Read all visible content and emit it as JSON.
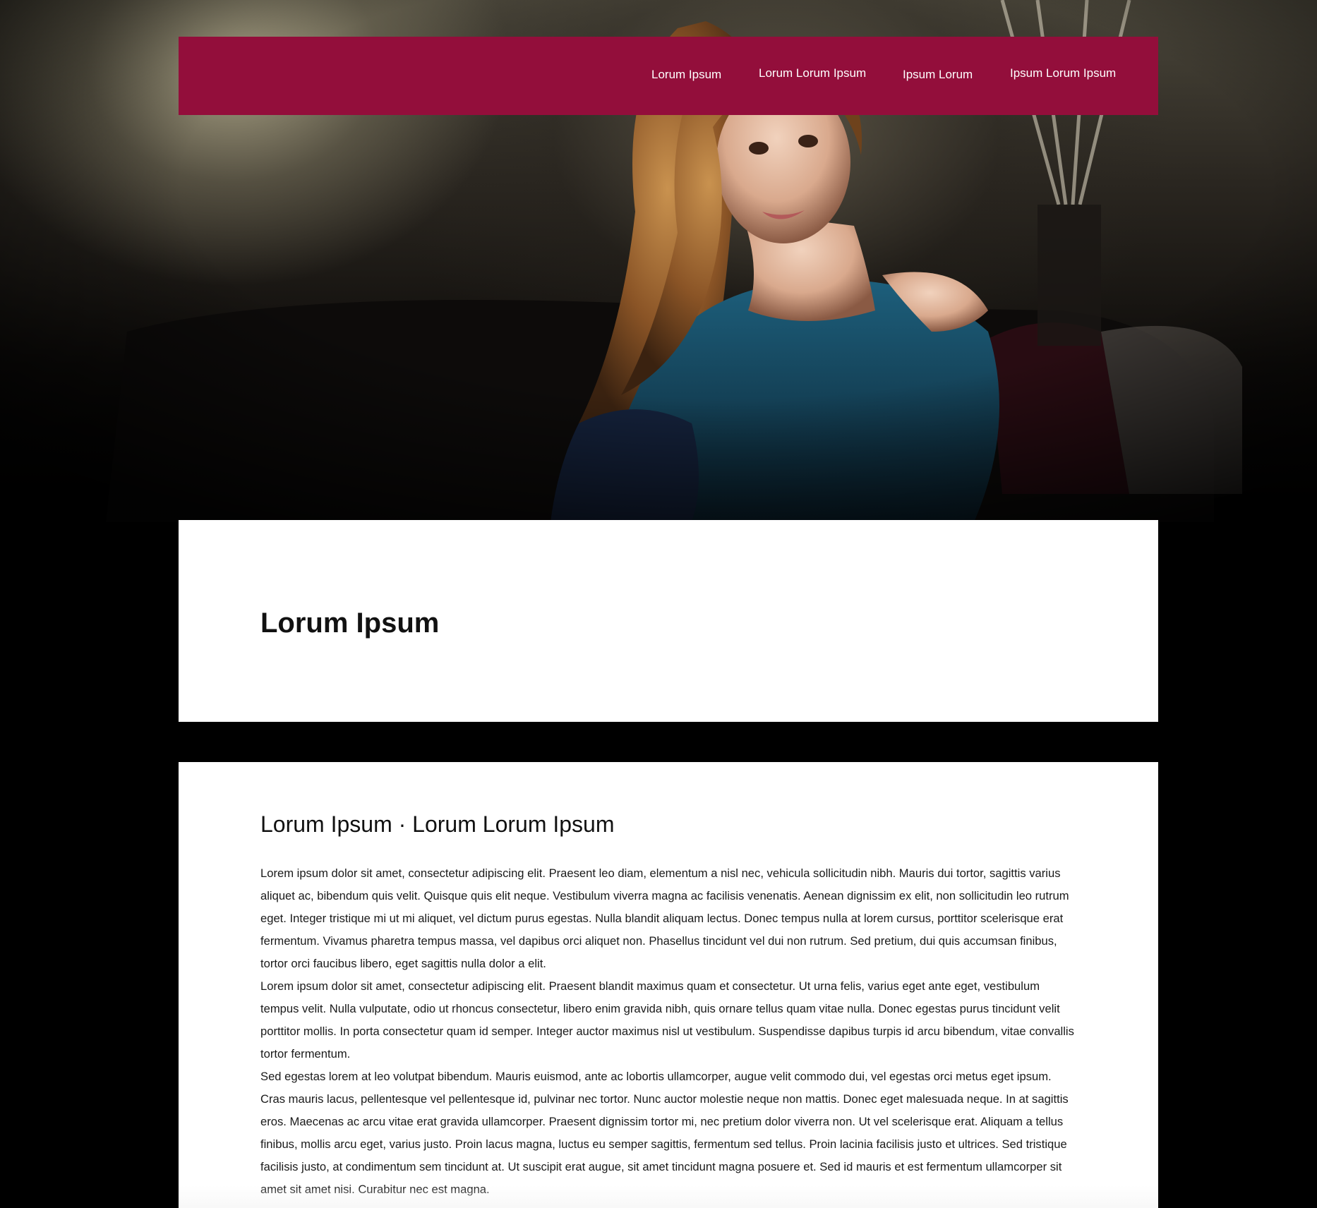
{
  "nav": {
    "items": [
      {
        "label": "Lorum Ipsum"
      },
      {
        "label": "Lorum Lorum Ipsum"
      },
      {
        "label": "Ipsum Lorum"
      },
      {
        "label": "Ipsum Lorum Ipsum"
      }
    ]
  },
  "hero": {
    "image": "portrait-photo"
  },
  "title_panel": {
    "title": "Lorum Ipsum"
  },
  "content": {
    "heading": "Lorum Ipsum · Lorum Lorum Ipsum",
    "paragraphs": [
      "Lorem ipsum dolor sit amet, consectetur adipiscing elit. Praesent leo diam, elementum a nisl nec, vehicula sollicitudin nibh. Mauris dui tortor, sagittis varius aliquet ac, bibendum quis velit. Quisque quis elit neque. Vestibulum viverra magna ac facilisis venenatis. Aenean dignissim ex elit, non sollicitudin leo rutrum eget. Integer tristique mi ut mi aliquet, vel dictum purus egestas. Nulla blandit aliquam lectus. Donec tempus nulla at lorem cursus, porttitor scelerisque erat fermentum. Vivamus pharetra tempus massa, vel dapibus orci aliquet non. Phasellus tincidunt vel dui non rutrum. Sed pretium, dui quis accumsan finibus, tortor orci faucibus libero, eget sagittis nulla dolor a elit.",
      "Lorem ipsum dolor sit amet, consectetur adipiscing elit. Praesent blandit maximus quam et consectetur. Ut urna felis, varius eget ante eget, vestibulum tempus velit. Nulla vulputate, odio ut rhoncus consectetur, libero enim gravida nibh, quis ornare tellus quam vitae nulla. Donec egestas purus tincidunt velit porttitor mollis. In porta consectetur quam id semper. Integer auctor maximus nisl ut vestibulum. Suspendisse dapibus turpis id arcu bibendum, vitae convallis tortor fermentum.",
      "Sed egestas lorem at leo volutpat bibendum. Mauris euismod, ante ac lobortis ullamcorper, augue velit commodo dui, vel egestas orci metus eget ipsum. Cras mauris lacus, pellentesque vel pellentesque id, pulvinar nec tortor. Nunc auctor molestie neque non mattis. Donec eget malesuada neque. In at sagittis eros. Maecenas ac arcu vitae erat gravida ullamcorper. Praesent dignissim tortor mi, nec pretium dolor viverra non. Ut vel scelerisque erat. Aliquam a tellus finibus, mollis arcu eget, varius justo. Proin lacus magna, luctus eu semper sagittis, fermentum sed tellus. Proin lacinia facilisis justo et ultrices. Sed tristique facilisis justo, at condimentum sem tincidunt at. Ut suscipit erat augue, sit amet tincidunt magna posuere et. Sed id mauris et est fermentum ullamcorper sit amet sit amet nisi. Curabitur nec est magna."
    ]
  },
  "colors": {
    "nav_background": "#930e3b",
    "page_background": "#000000",
    "panel_background": "#ffffff"
  }
}
